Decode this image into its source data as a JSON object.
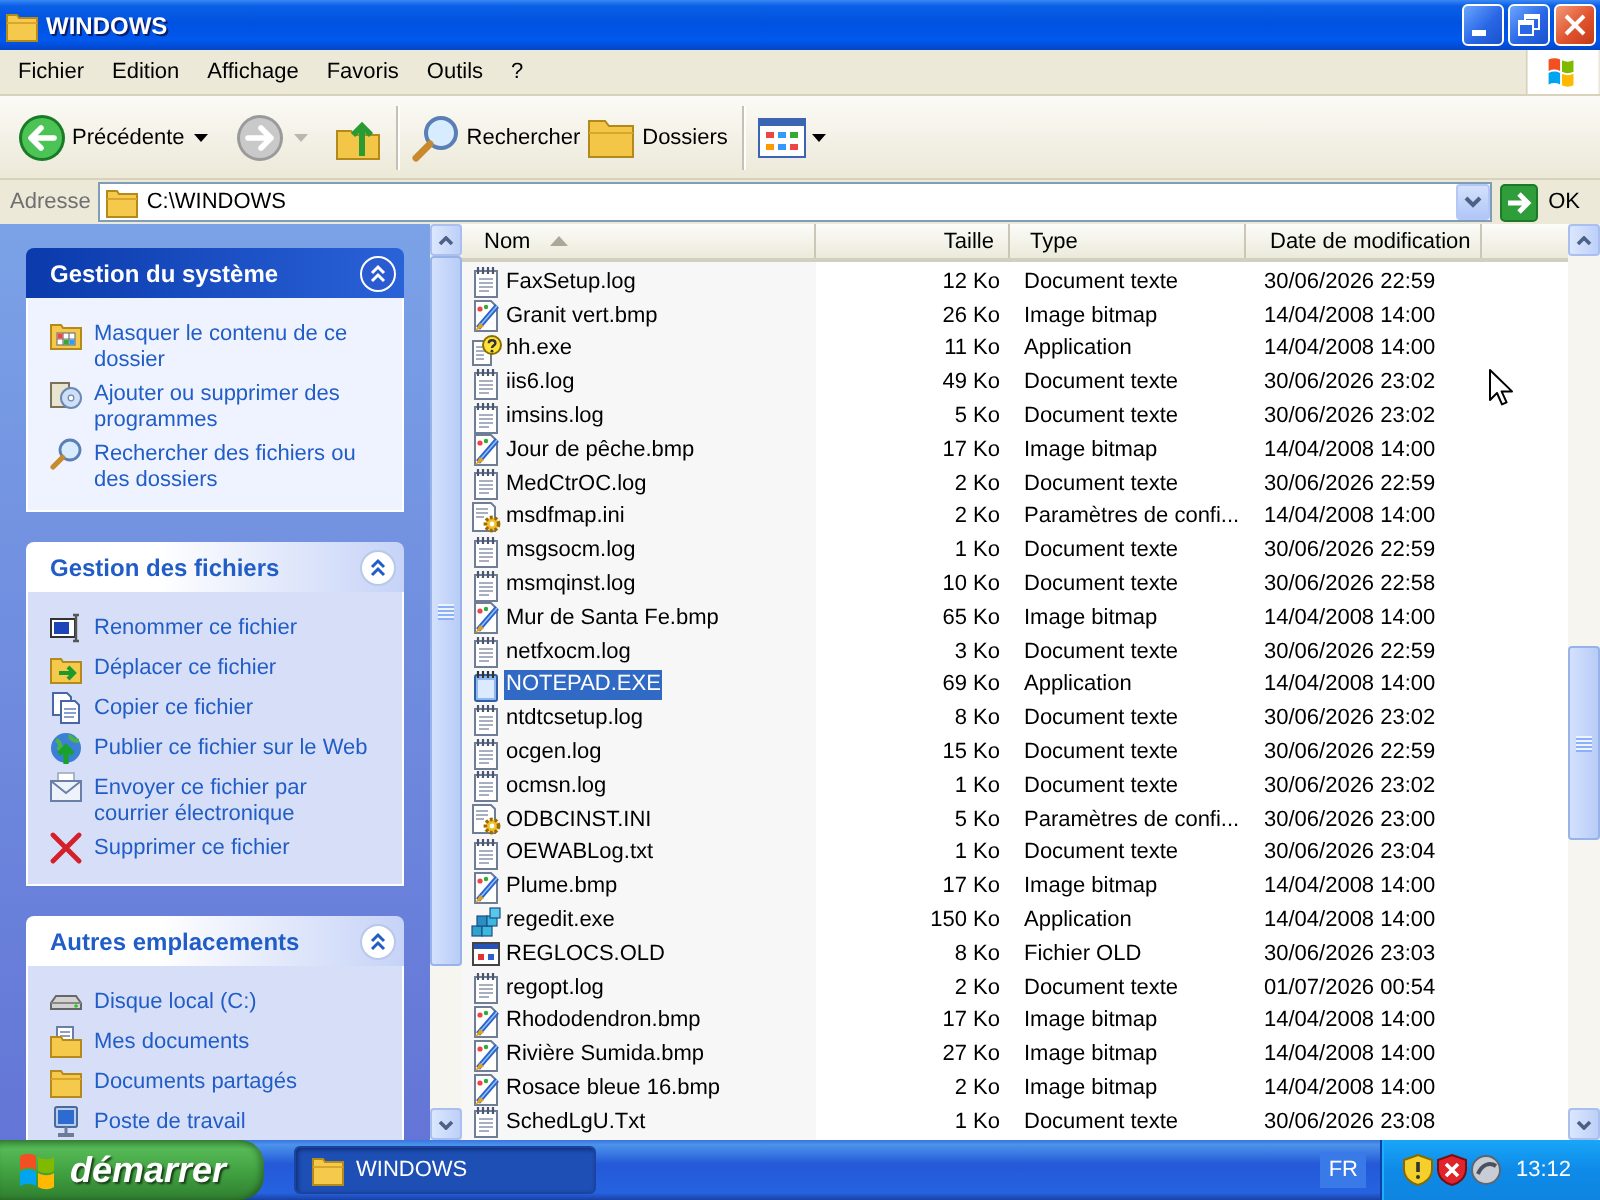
{
  "window": {
    "title": "WINDOWS"
  },
  "menu": [
    "Fichier",
    "Edition",
    "Affichage",
    "Favoris",
    "Outils",
    "?"
  ],
  "toolbar": {
    "back": {
      "label": "Précédente",
      "disabled": false
    },
    "forward": {
      "disabled": true
    },
    "search": {
      "label": "Rechercher"
    },
    "folders": {
      "label": "Dossiers"
    }
  },
  "address_bar": {
    "label": "Adresse",
    "value": "C:\\WINDOWS",
    "go_button": "OK"
  },
  "task_pane": [
    {
      "title": "Gestion du système",
      "kind": "special",
      "expanded": true,
      "items": [
        {
          "label": "Masquer le contenu de ce dossier",
          "kind": "hide"
        },
        {
          "label": "Ajouter ou supprimer des programmes",
          "kind": "programs"
        },
        {
          "label": "Rechercher des fichiers ou des dossiers",
          "kind": "search"
        }
      ]
    },
    {
      "title": "Gestion des fichiers",
      "kind": "normal",
      "expanded": true,
      "items": [
        {
          "label": "Renommer ce fichier",
          "kind": "rename"
        },
        {
          "label": "Déplacer ce fichier",
          "kind": "move"
        },
        {
          "label": "Copier ce fichier",
          "kind": "copy"
        },
        {
          "label": "Publier ce fichier sur le Web",
          "kind": "publish"
        },
        {
          "label": "Envoyer ce fichier par courrier électronique",
          "kind": "email"
        },
        {
          "label": "Supprimer ce fichier",
          "kind": "delete"
        }
      ]
    },
    {
      "title": "Autres emplacements",
      "kind": "normal",
      "expanded": true,
      "items": [
        {
          "label": "Disque local (C:)",
          "kind": "drive"
        },
        {
          "label": "Mes documents",
          "kind": "documents"
        },
        {
          "label": "Documents partagés",
          "kind": "shared"
        },
        {
          "label": "Poste de travail",
          "kind": "computer"
        }
      ]
    }
  ],
  "file_list": {
    "columns": [
      {
        "label": "Nom",
        "sorted": true
      },
      {
        "label": "Taille",
        "sorted": false
      },
      {
        "label": "Type",
        "sorted": false
      },
      {
        "label": "Date de modification",
        "sorted": false
      }
    ],
    "rows": [
      {
        "name": "FaxSetup.log",
        "size": "12 Ko",
        "type": "Document texte",
        "modified": "30/06/2026 22:59",
        "kind": "text",
        "selected": false
      },
      {
        "name": "Granit vert.bmp",
        "size": "26 Ko",
        "type": "Image bitmap",
        "modified": "14/04/2008 14:00",
        "kind": "image",
        "selected": false
      },
      {
        "name": "hh.exe",
        "size": "11 Ko",
        "type": "Application",
        "modified": "14/04/2008 14:00",
        "kind": "help",
        "selected": false
      },
      {
        "name": "iis6.log",
        "size": "49 Ko",
        "type": "Document texte",
        "modified": "30/06/2026 23:02",
        "kind": "text",
        "selected": false
      },
      {
        "name": "imsins.log",
        "size": "5 Ko",
        "type": "Document texte",
        "modified": "30/06/2026 23:02",
        "kind": "text",
        "selected": false
      },
      {
        "name": "Jour de pêche.bmp",
        "size": "17 Ko",
        "type": "Image bitmap",
        "modified": "14/04/2008 14:00",
        "kind": "image",
        "selected": false
      },
      {
        "name": "MedCtrOC.log",
        "size": "2 Ko",
        "type": "Document texte",
        "modified": "30/06/2026 22:59",
        "kind": "text",
        "selected": false
      },
      {
        "name": "msdfmap.ini",
        "size": "2 Ko",
        "type": "Paramètres de confi...",
        "modified": "14/04/2008 14:00",
        "kind": "settings",
        "selected": false
      },
      {
        "name": "msgsocm.log",
        "size": "1 Ko",
        "type": "Document texte",
        "modified": "30/06/2026 22:59",
        "kind": "text",
        "selected": false
      },
      {
        "name": "msmqinst.log",
        "size": "10 Ko",
        "type": "Document texte",
        "modified": "30/06/2026 22:58",
        "kind": "text",
        "selected": false
      },
      {
        "name": "Mur de Santa Fe.bmp",
        "size": "65 Ko",
        "type": "Image bitmap",
        "modified": "14/04/2008 14:00",
        "kind": "image",
        "selected": false
      },
      {
        "name": "netfxocm.log",
        "size": "3 Ko",
        "type": "Document texte",
        "modified": "30/06/2026 22:59",
        "kind": "text",
        "selected": false
      },
      {
        "name": "NOTEPAD.EXE",
        "size": "69 Ko",
        "type": "Application",
        "modified": "14/04/2008 14:00",
        "kind": "notepad",
        "selected": true
      },
      {
        "name": "ntdtcsetup.log",
        "size": "8 Ko",
        "type": "Document texte",
        "modified": "30/06/2026 23:02",
        "kind": "text",
        "selected": false
      },
      {
        "name": "ocgen.log",
        "size": "15 Ko",
        "type": "Document texte",
        "modified": "30/06/2026 22:59",
        "kind": "text",
        "selected": false
      },
      {
        "name": "ocmsn.log",
        "size": "1 Ko",
        "type": "Document texte",
        "modified": "30/06/2026 23:02",
        "kind": "text",
        "selected": false
      },
      {
        "name": "ODBCINST.INI",
        "size": "5 Ko",
        "type": "Paramètres de confi...",
        "modified": "30/06/2026 23:00",
        "kind": "settings",
        "selected": false
      },
      {
        "name": "OEWABLog.txt",
        "size": "1 Ko",
        "type": "Document texte",
        "modified": "30/06/2026 23:04",
        "kind": "text",
        "selected": false
      },
      {
        "name": "Plume.bmp",
        "size": "17 Ko",
        "type": "Image bitmap",
        "modified": "14/04/2008 14:00",
        "kind": "image",
        "selected": false
      },
      {
        "name": "regedit.exe",
        "size": "150 Ko",
        "type": "Application",
        "modified": "14/04/2008 14:00",
        "kind": "registry",
        "selected": false
      },
      {
        "name": "REGLOCS.OLD",
        "size": "8 Ko",
        "type": "Fichier OLD",
        "modified": "30/06/2026 23:03",
        "kind": "window",
        "selected": false
      },
      {
        "name": "regopt.log",
        "size": "2 Ko",
        "type": "Document texte",
        "modified": "01/07/2026 00:54",
        "kind": "text",
        "selected": false
      },
      {
        "name": "Rhododendron.bmp",
        "size": "17 Ko",
        "type": "Image bitmap",
        "modified": "14/04/2008 14:00",
        "kind": "image",
        "selected": false
      },
      {
        "name": "Rivière Sumida.bmp",
        "size": "27 Ko",
        "type": "Image bitmap",
        "modified": "14/04/2008 14:00",
        "kind": "image",
        "selected": false
      },
      {
        "name": "Rosace bleue 16.bmp",
        "size": "2 Ko",
        "type": "Image bitmap",
        "modified": "14/04/2008 14:00",
        "kind": "image",
        "selected": false
      },
      {
        "name": "SchedLgU.Txt",
        "size": "1 Ko",
        "type": "Document texte",
        "modified": "30/06/2026 23:08",
        "kind": "text",
        "selected": false
      }
    ]
  },
  "taskbar": {
    "start_button": "démarrer",
    "tasks": [
      {
        "label": "WINDOWS",
        "active": true
      }
    ],
    "language": "FR",
    "clock": "13:12"
  }
}
